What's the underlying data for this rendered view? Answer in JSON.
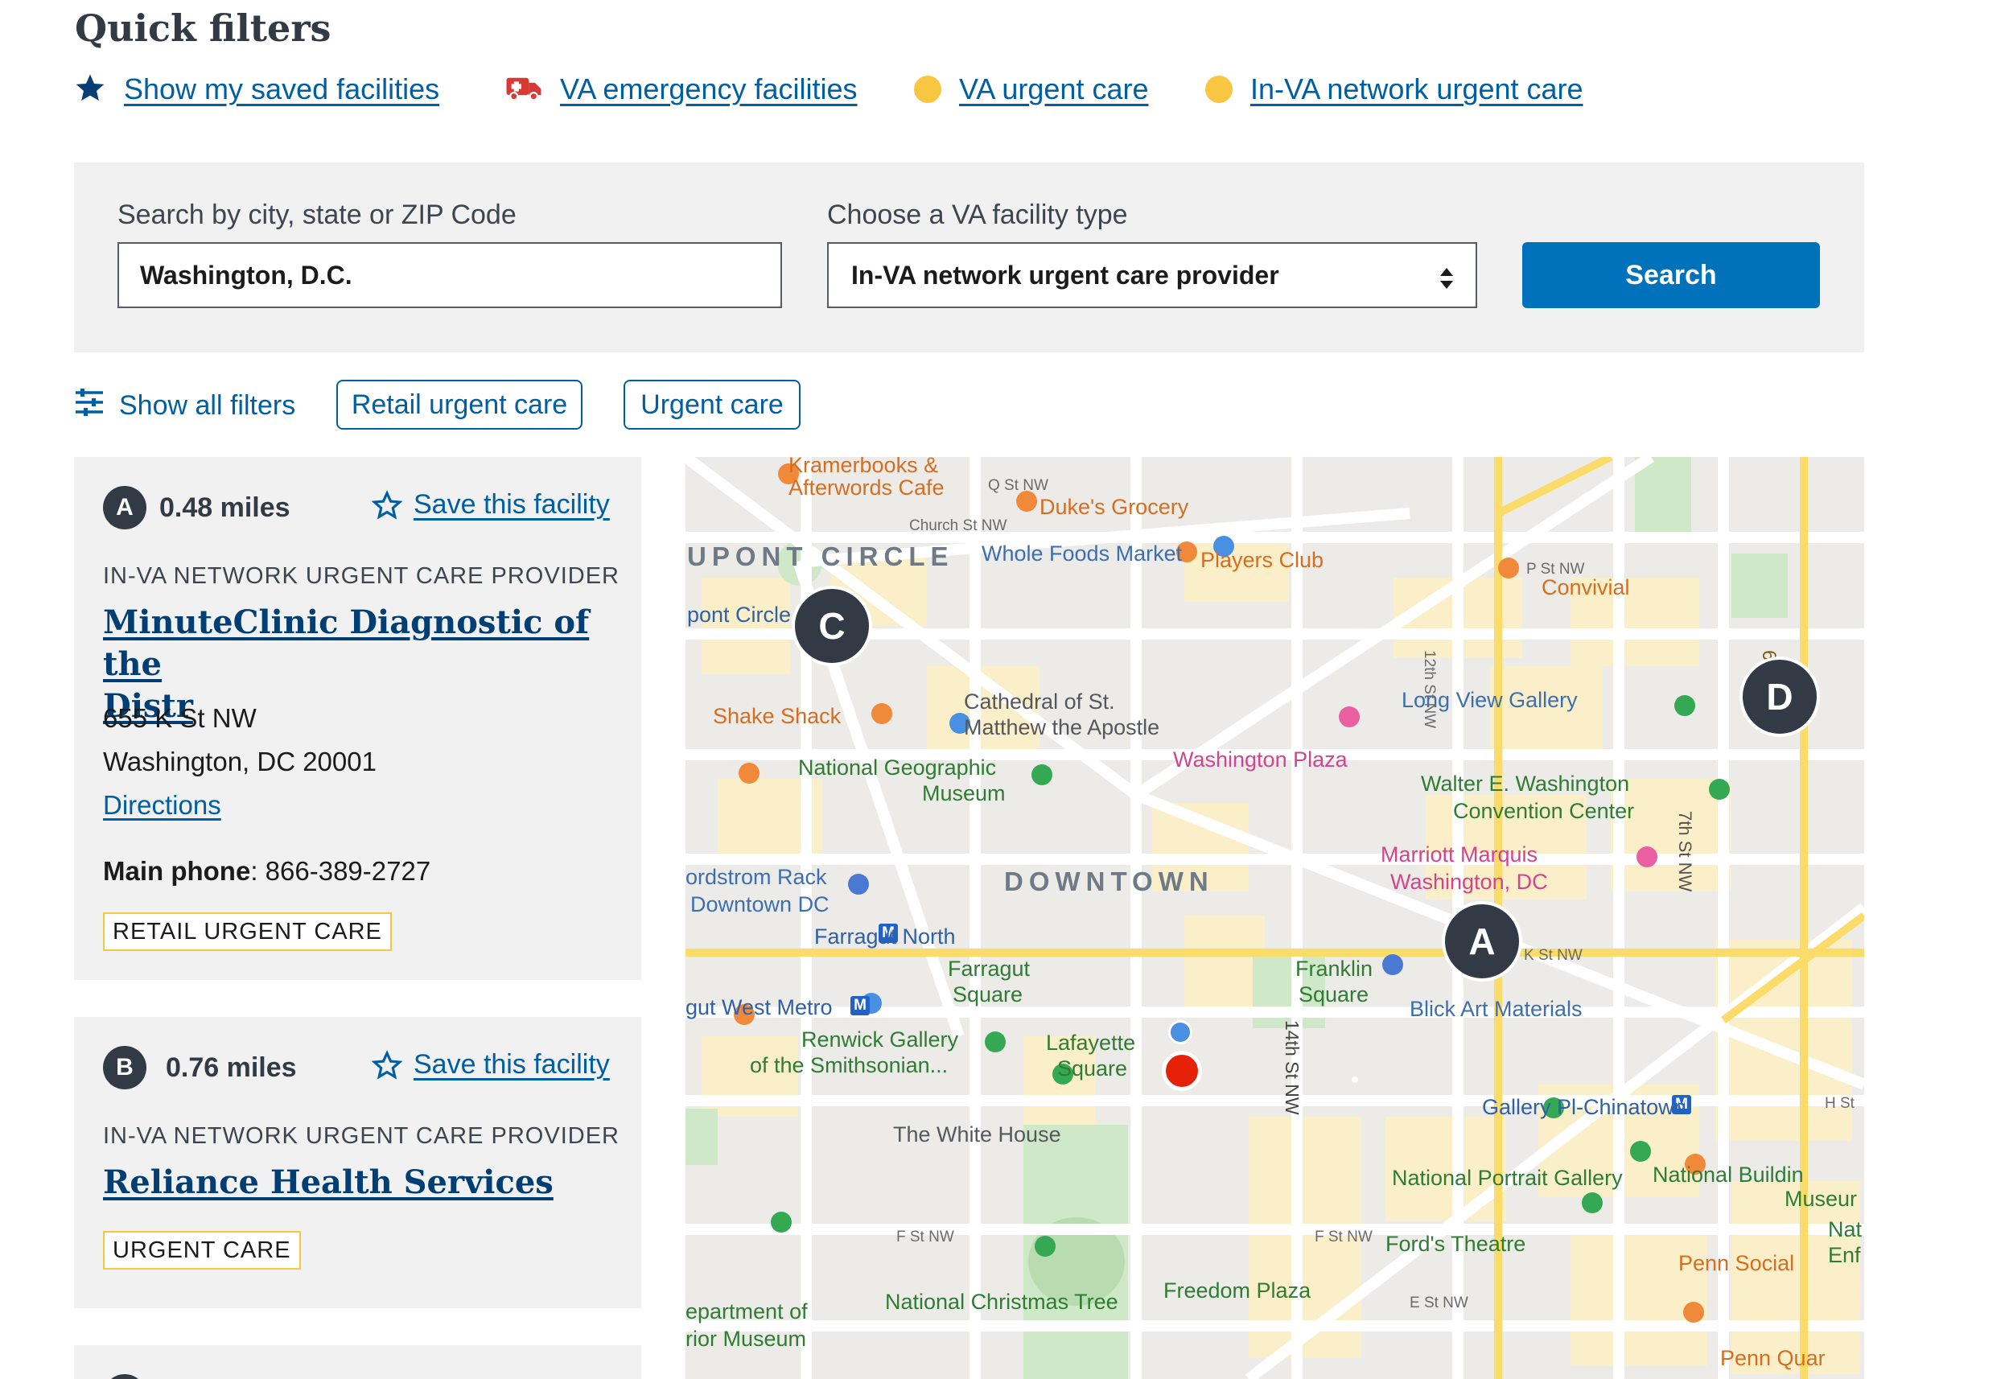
{
  "quick_filters": {
    "title": "Quick filters",
    "items": [
      {
        "label": "Show my saved facilities",
        "icon": "star-icon"
      },
      {
        "label": "VA emergency facilities",
        "icon": "ambulance-icon"
      },
      {
        "label": "VA urgent care",
        "icon": "yellow-dot-icon"
      },
      {
        "label": "In-VA network urgent care",
        "icon": "yellow-dot-icon"
      }
    ]
  },
  "search": {
    "city_label": "Search by city, state or ZIP Code",
    "city_value": "Washington, D.C.",
    "type_label": "Choose a VA facility type",
    "type_value": "In-VA network urgent care provider",
    "button_label": "Search"
  },
  "filters": {
    "show_all_label": "Show all filters",
    "chips": [
      "Retail urgent care",
      "Urgent care"
    ]
  },
  "results": [
    {
      "marker": "A",
      "distance": "0.48 miles",
      "save_label": "Save this facility",
      "type": "IN-VA NETWORK URGENT CARE PROVIDER",
      "name_line1": "MinuteClinic Diagnostic of the",
      "name_line2": "Distr",
      "address_line1": "655 K St NW",
      "address_line2": "Washington, DC 20001",
      "directions_label": "Directions",
      "phone_label": "Main phone",
      "phone": ": 866-389-2727",
      "tag": "RETAIL URGENT CARE"
    },
    {
      "marker": "B",
      "distance": "0.76 miles",
      "save_label": "Save this facility",
      "type": "IN-VA NETWORK URGENT CARE PROVIDER",
      "name": "Reliance Health Services",
      "tag": "URGENT CARE"
    }
  ],
  "map": {
    "markers": [
      "A",
      "C",
      "D"
    ],
    "labels": {
      "kramerbooks": "Kramerbooks &",
      "afterwords": "Afterwords Cafe",
      "dukes": "Duke's Grocery",
      "dupont": "UPONT CIRCLE",
      "wholefoods": "Whole Foods Market",
      "players": "Players Club",
      "convivial": "Convivial",
      "dupont_metro": "pont Circle",
      "shakeshack": "Shake Shack",
      "cathedral1": "Cathedral of St.",
      "cathedral2": "Matthew the Apostle",
      "longview": "Long View Gallery",
      "washplaza": "Washington Plaza",
      "natgeo1": "National Geographic",
      "natgeo2": "Museum",
      "walter1": "Walter E. Washington",
      "walter2": "Convention Center",
      "marriott1": "Marriott Marquis",
      "marriott2": "Washington, DC",
      "nordstrom1": "ordstrom Rack",
      "nordstrom2": "Downtown DC",
      "downtown": "DOWNTOWN",
      "farragutnorth": "Farragut North",
      "farragut1": "Farragut",
      "farragut2": "Square",
      "franklin1": "Franklin",
      "franklin2": "Square",
      "blick": "Blick Art Materials",
      "farragutwest": "gut West Metro",
      "renwick1": "Renwick Gallery",
      "renwick2": "of the Smithsonian...",
      "lafayette1": "Lafayette",
      "lafayette2": "Square",
      "galleryplace": "Gallery Pl-Chinatown",
      "whitehouse": "The White House",
      "portrait": "National Portrait Gallery",
      "natbuilding1": "National Buildin",
      "natbuilding2": "Museur",
      "fords": "Ford's Theatre",
      "pennsocial": "Penn Social",
      "freedom": "Freedom Plaza",
      "interior1": "epartment of",
      "interior2": "rior Museum",
      "xmastree": "National Christmas Tree",
      "pennquarter": "Penn Quar",
      "nat_enf1": "Nat",
      "nat_enf2": "Enf",
      "st_q": "Q St NW",
      "st_church": "Church St NW",
      "st_p": "P St NW",
      "st_12": "12th St NW",
      "st_14": "14th St NW",
      "st_6": "6th St N",
      "st_7": "7th St NW",
      "st_f": "F St NW",
      "st_f2": "F St NW",
      "st_e": "E St NW",
      "st_k": "K St NW",
      "st_h": "H St"
    }
  }
}
